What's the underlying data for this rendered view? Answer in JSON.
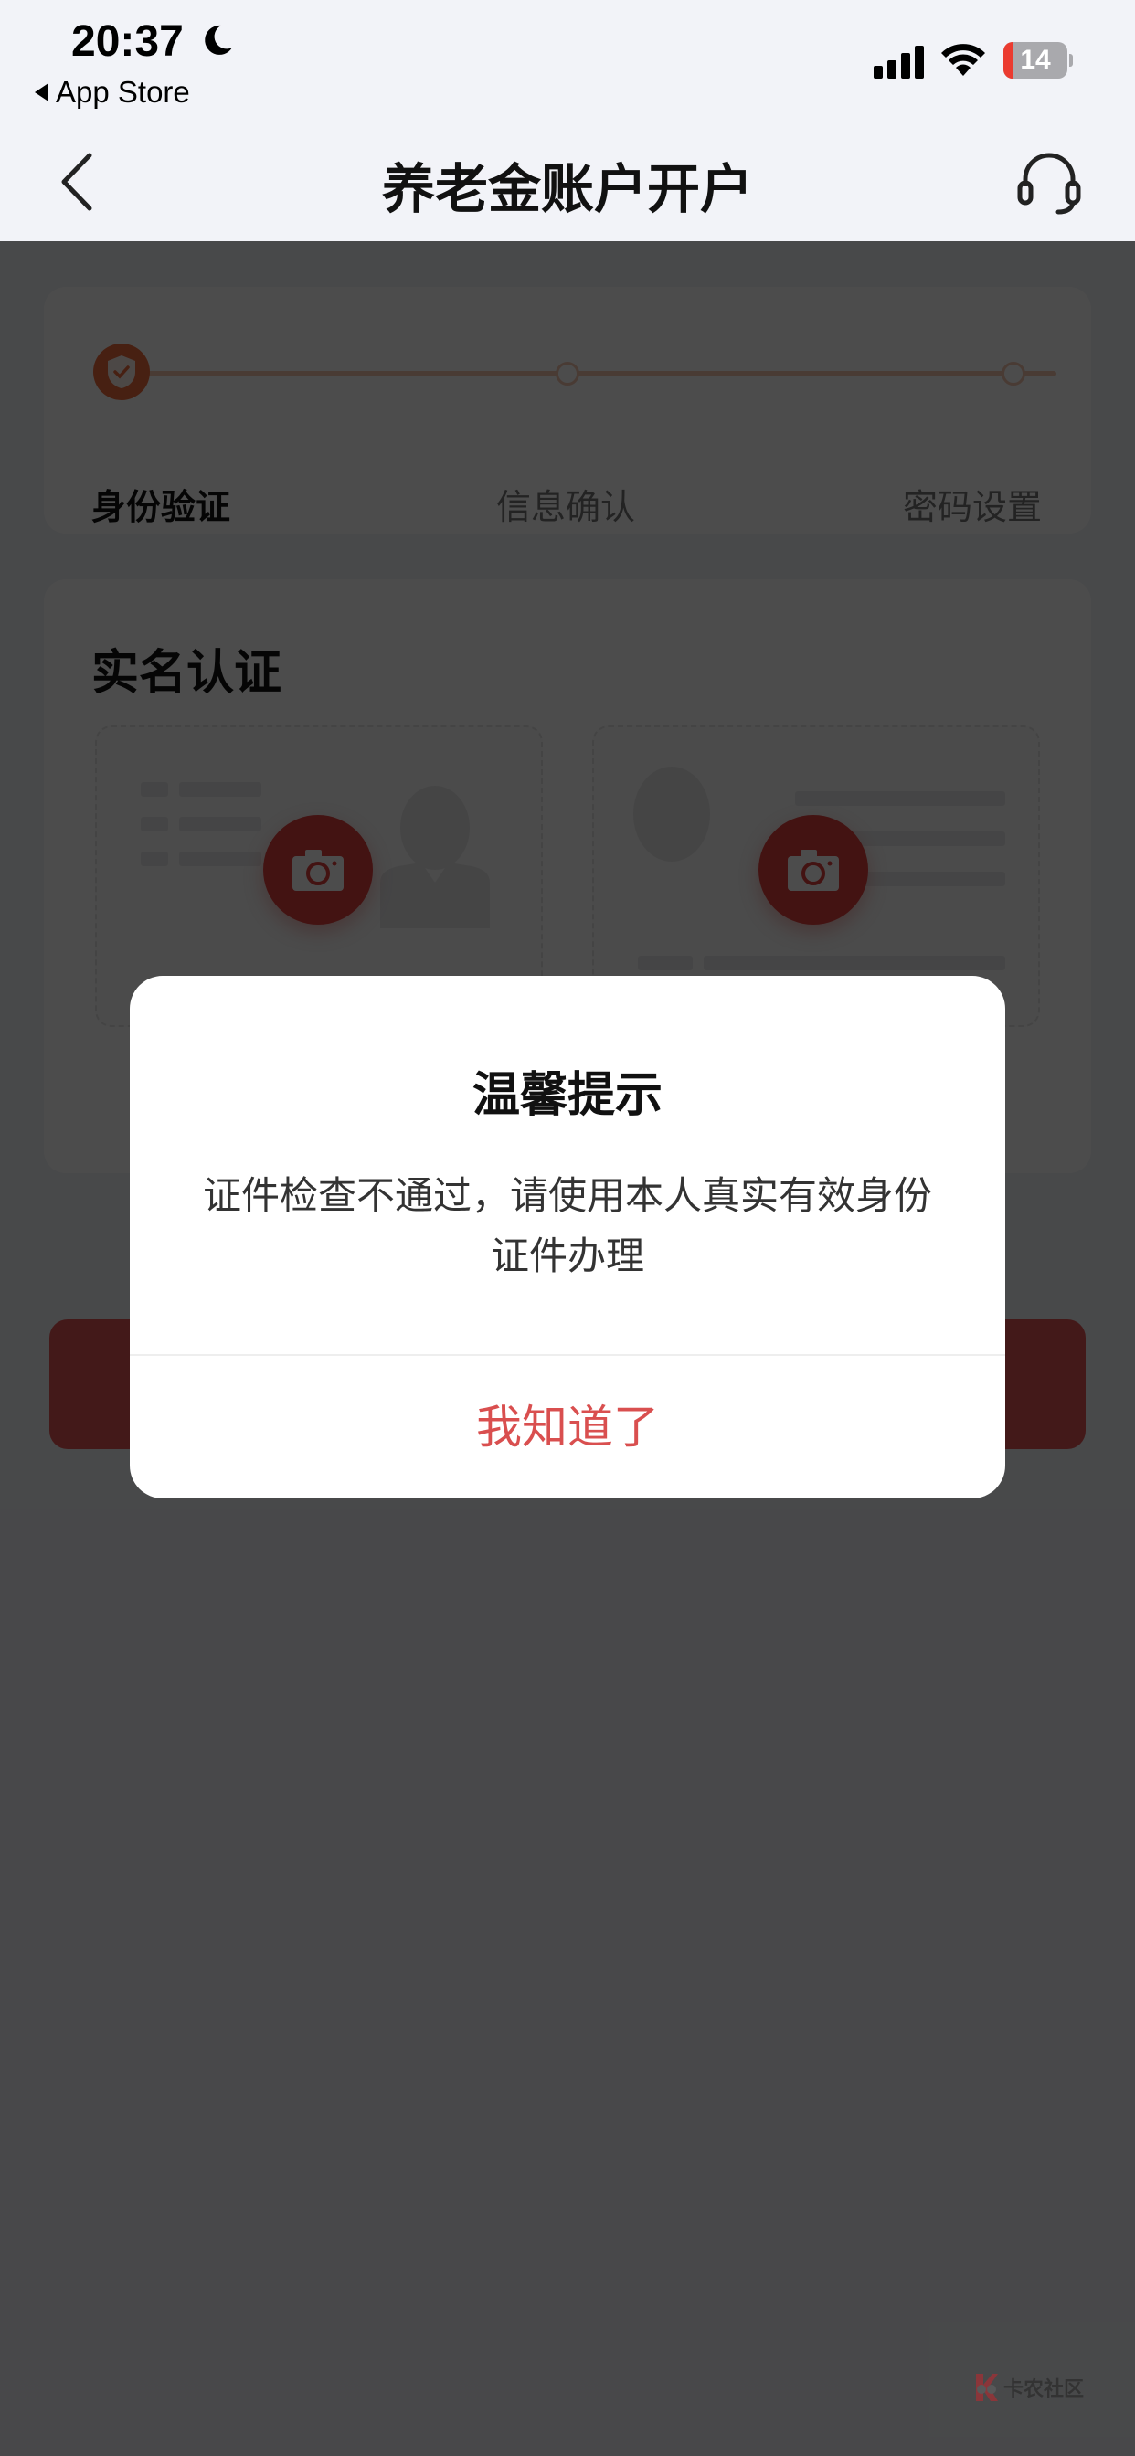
{
  "status_bar": {
    "time": "20:37",
    "back_app": "App Store",
    "battery_level": "14",
    "battery_percent": 14,
    "icons": [
      "moon-icon",
      "signal-icon",
      "wifi-icon",
      "battery-icon"
    ]
  },
  "nav": {
    "title": "养老金账户开户",
    "back_icon": "chevron-left-icon",
    "support_icon": "headset-icon"
  },
  "steps": {
    "current_index": 0,
    "items": [
      {
        "label": "身份验证",
        "state": "active"
      },
      {
        "label": "信息确认",
        "state": "pending"
      },
      {
        "label": "密码设置",
        "state": "pending"
      }
    ]
  },
  "auth": {
    "title": "实名认证",
    "slots": [
      {
        "name": "id-front",
        "icon": "camera-icon"
      },
      {
        "name": "id-back",
        "icon": "camera-icon"
      }
    ]
  },
  "dialog": {
    "title": "温馨提示",
    "message": "证件检查不通过，请使用本人真实有效身份证件办理",
    "confirm_label": "我知道了"
  },
  "watermark": {
    "text": "卡农社区"
  },
  "colors": {
    "accent": "#d94f4f",
    "step_active": "#ee6b3e",
    "camera_button": "#e0413f",
    "overlay": "rgba(0,0,0,0.7)"
  }
}
